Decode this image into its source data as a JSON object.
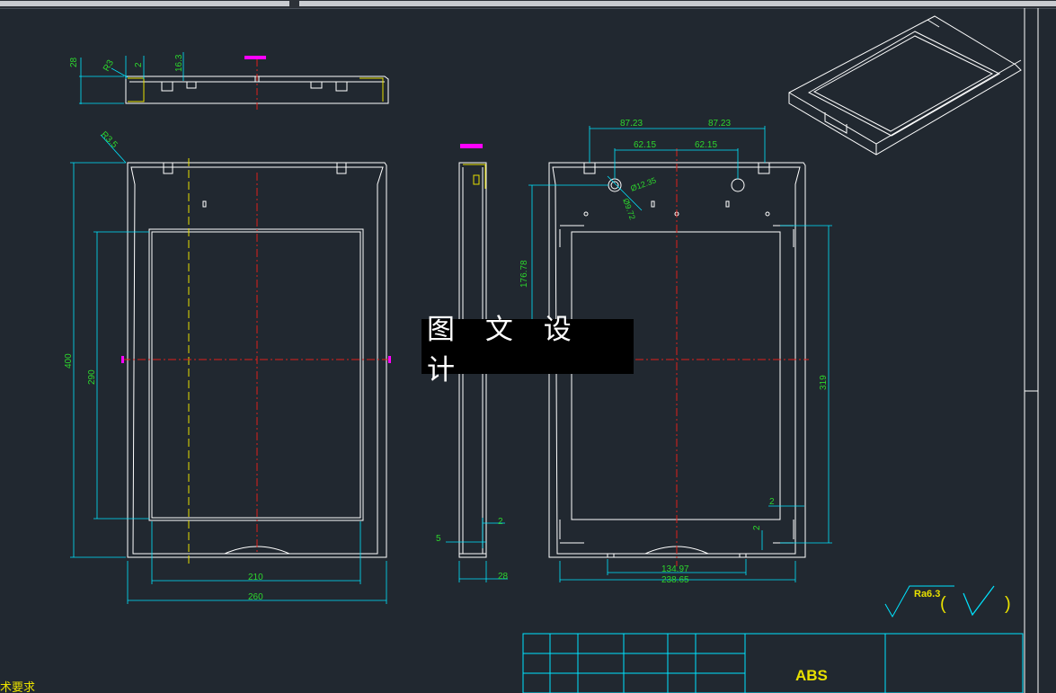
{
  "window": {
    "toolbar_segments": [
      "tab-1",
      "tab-2"
    ]
  },
  "colors": {
    "background": "#212830",
    "outline": "#ffffff",
    "dimension": "#00e5ff",
    "dim_text": "#2dd62d",
    "centerline": "#e0201a",
    "hidden": "#e8e000",
    "marker": "#ff00ff",
    "table": "#00e5ff"
  },
  "drawing": {
    "top_view": {
      "dims": {
        "height": "28",
        "radius": "R3",
        "wall": "2",
        "depth": "16.3"
      }
    },
    "front_view": {
      "dims": {
        "corner_radius": "R3.5",
        "height": "400",
        "window_height": "290",
        "window_width": "210",
        "width": "260"
      }
    },
    "side_view": {
      "dims": {
        "step": "5",
        "wall": "2",
        "thickness": "28"
      }
    },
    "rear_view": {
      "dims": {
        "spacing_outer_left": "87.23",
        "spacing_outer_right": "87.23",
        "spacing_inner_left": "62.15",
        "spacing_inner_right": "62.15",
        "hole_outer": "Ø12.35",
        "hole_inner": "Ø9.72",
        "hole_offset": "176.78",
        "frame_height": "319",
        "gap_right": "2",
        "gap_bottom": "2",
        "notch_width": "134.97",
        "inner_width": "238.65"
      }
    },
    "roughness": {
      "value": "Ra6.3",
      "paren_open": "(",
      "paren_close": ")"
    },
    "watermark": "图 文 设 计",
    "title_block": {
      "material": "ABS"
    },
    "tech_req_label": "术要求"
  }
}
